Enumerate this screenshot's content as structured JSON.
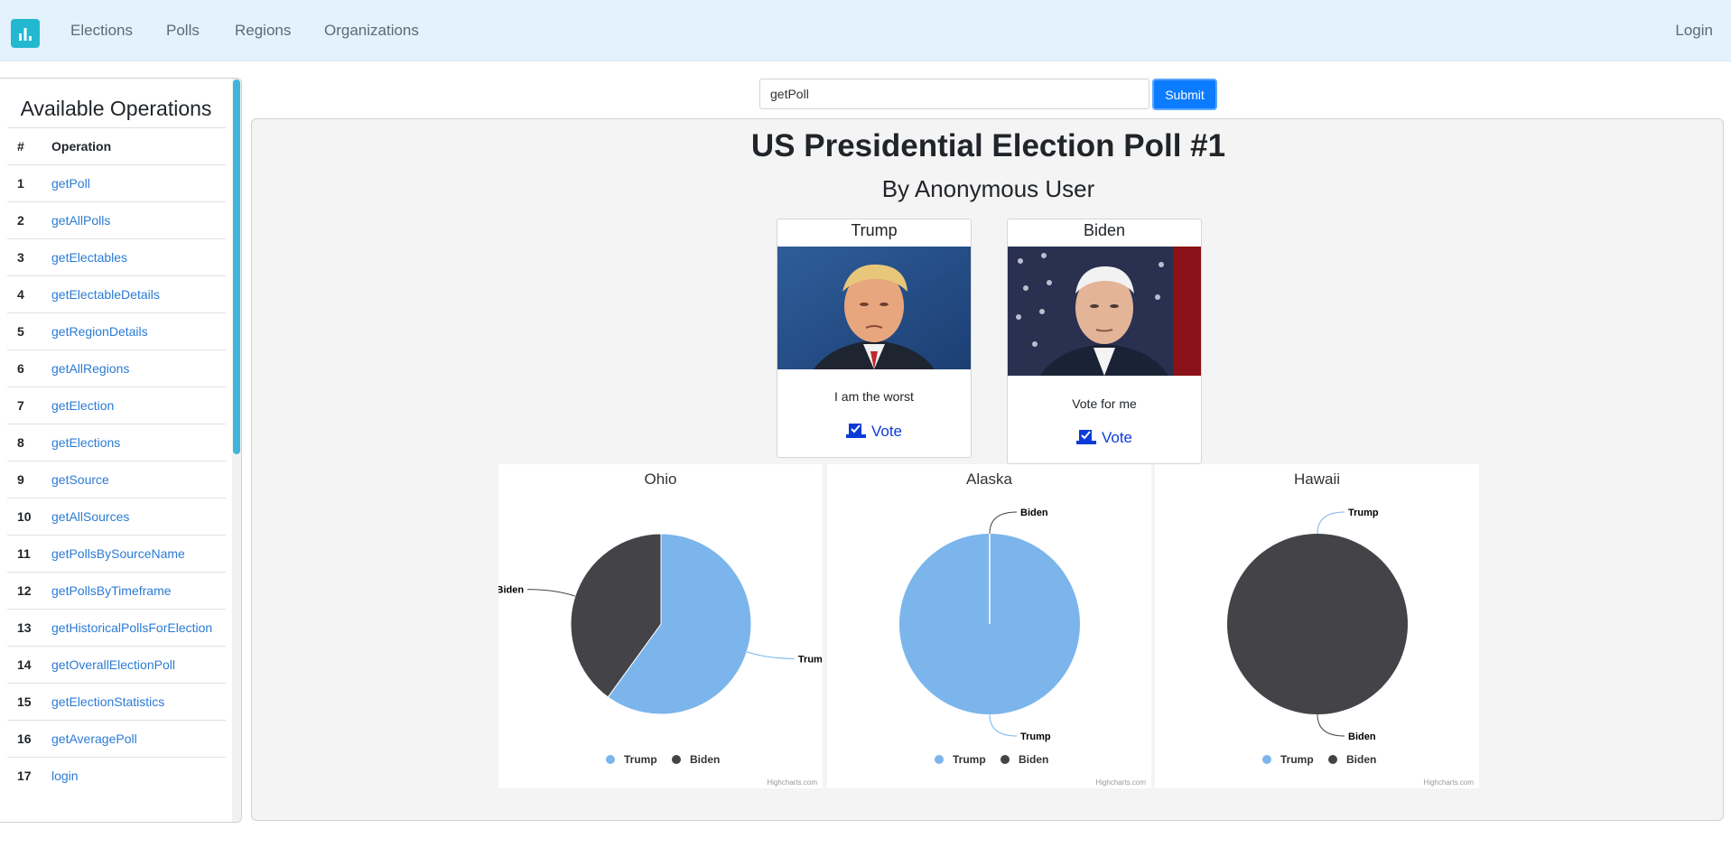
{
  "nav": {
    "links": [
      "Elections",
      "Polls",
      "Regions",
      "Organizations"
    ],
    "login": "Login"
  },
  "sidebar": {
    "title": "Available Operations",
    "header": {
      "num": "#",
      "op": "Operation"
    },
    "operations": [
      "getPoll",
      "getAllPolls",
      "getElectables",
      "getElectableDetails",
      "getRegionDetails",
      "getAllRegions",
      "getElection",
      "getElections",
      "getSource",
      "getAllSources",
      "getPollsBySourceName",
      "getPollsByTimeframe",
      "getHistoricalPollsForElection",
      "getOverallElectionPoll",
      "getElectionStatistics",
      "getAveragePoll",
      "login"
    ]
  },
  "query": {
    "value": "getPoll",
    "submit": "Submit"
  },
  "poll": {
    "title": "US Presidential Election Poll #1",
    "subtitle": "By Anonymous User",
    "candidates": [
      {
        "name": "Trump",
        "quote": "I am the worst",
        "vote": "Vote"
      },
      {
        "name": "Biden",
        "quote": "Vote for me",
        "vote": "Vote"
      }
    ]
  },
  "colors": {
    "trump": "#7cb5ec",
    "biden": "#434348",
    "accent": "#0b7bff",
    "nav_bg": "#e3f2fd"
  },
  "chart_data": [
    {
      "type": "pie",
      "title": "Ohio",
      "categories": [
        "Trump",
        "Biden"
      ],
      "values": [
        60,
        40
      ],
      "legend": "bottom",
      "credits": "Highcharts.com"
    },
    {
      "type": "pie",
      "title": "Alaska",
      "categories": [
        "Trump",
        "Biden"
      ],
      "values": [
        100,
        0
      ],
      "legend": "bottom",
      "credits": "Highcharts.com"
    },
    {
      "type": "pie",
      "title": "Hawaii",
      "categories": [
        "Trump",
        "Biden"
      ],
      "values": [
        0,
        100
      ],
      "legend": "bottom",
      "credits": "Highcharts.com"
    }
  ]
}
